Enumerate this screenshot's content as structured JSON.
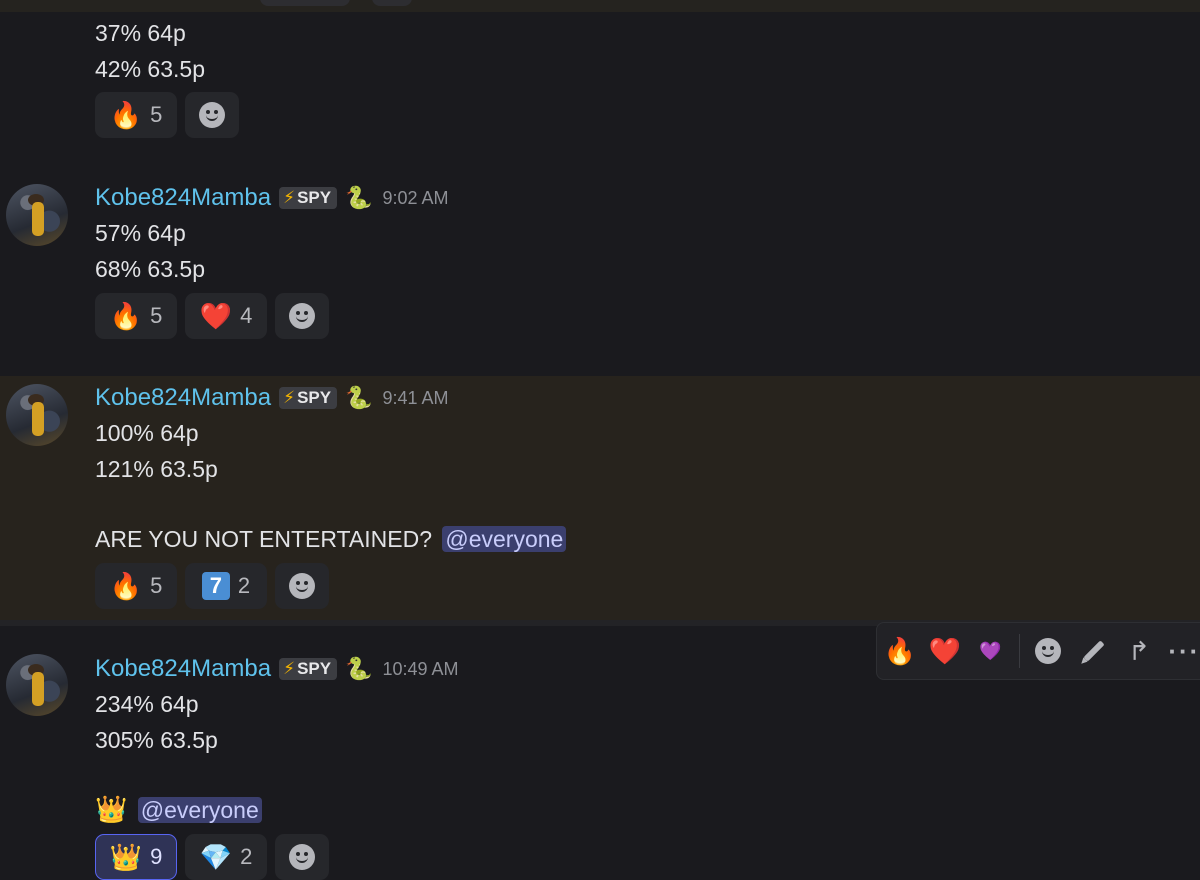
{
  "messages": [
    {
      "lines": [
        "37% 64p",
        "42% 63.5p"
      ],
      "reactions": [
        {
          "emoji": "🔥",
          "count": "5"
        }
      ]
    },
    {
      "username": "Kobe824Mamba",
      "tag": "SPY",
      "tag_icon": "lightning-bolt",
      "badge": "🐍",
      "time": "9:02 AM",
      "lines": [
        "57% 64p",
        "68% 63.5p"
      ],
      "reactions": [
        {
          "emoji": "🔥",
          "count": "5"
        },
        {
          "emoji": "❤️",
          "count": "4"
        }
      ]
    },
    {
      "username": "Kobe824Mamba",
      "tag": "SPY",
      "tag_icon": "lightning-bolt",
      "badge": "🐍",
      "time": "9:41 AM",
      "lines": [
        "100% 64p",
        "121% 63.5p"
      ],
      "extra_text": "ARE YOU NOT ENTERTAINED?",
      "mention": "@everyone",
      "reactions": [
        {
          "emoji": "🔥",
          "count": "5"
        },
        {
          "emoji": "7",
          "count": "2"
        }
      ]
    },
    {
      "username": "Kobe824Mamba",
      "tag": "SPY",
      "tag_icon": "lightning-bolt",
      "badge": "🐍",
      "time": "10:49 AM",
      "lines": [
        "234% 64p",
        "305% 63.5p"
      ],
      "extra_text": "👑",
      "mention": "@everyone",
      "reactions": [
        {
          "emoji": "👑",
          "count": "9",
          "active": true
        },
        {
          "emoji": "💎",
          "count": "2"
        }
      ]
    }
  ],
  "hover_toolbar": {
    "quick_reactions": [
      "🔥",
      "❤️",
      "💜"
    ],
    "actions": [
      "add-reaction",
      "edit",
      "forward",
      "more"
    ]
  },
  "colors": {
    "background": "#1a1a1e",
    "highlight": "#27231d",
    "username": "#5fc2ec",
    "mention_bg": "#3b3f6e",
    "active_reaction_border": "#5865f2"
  }
}
